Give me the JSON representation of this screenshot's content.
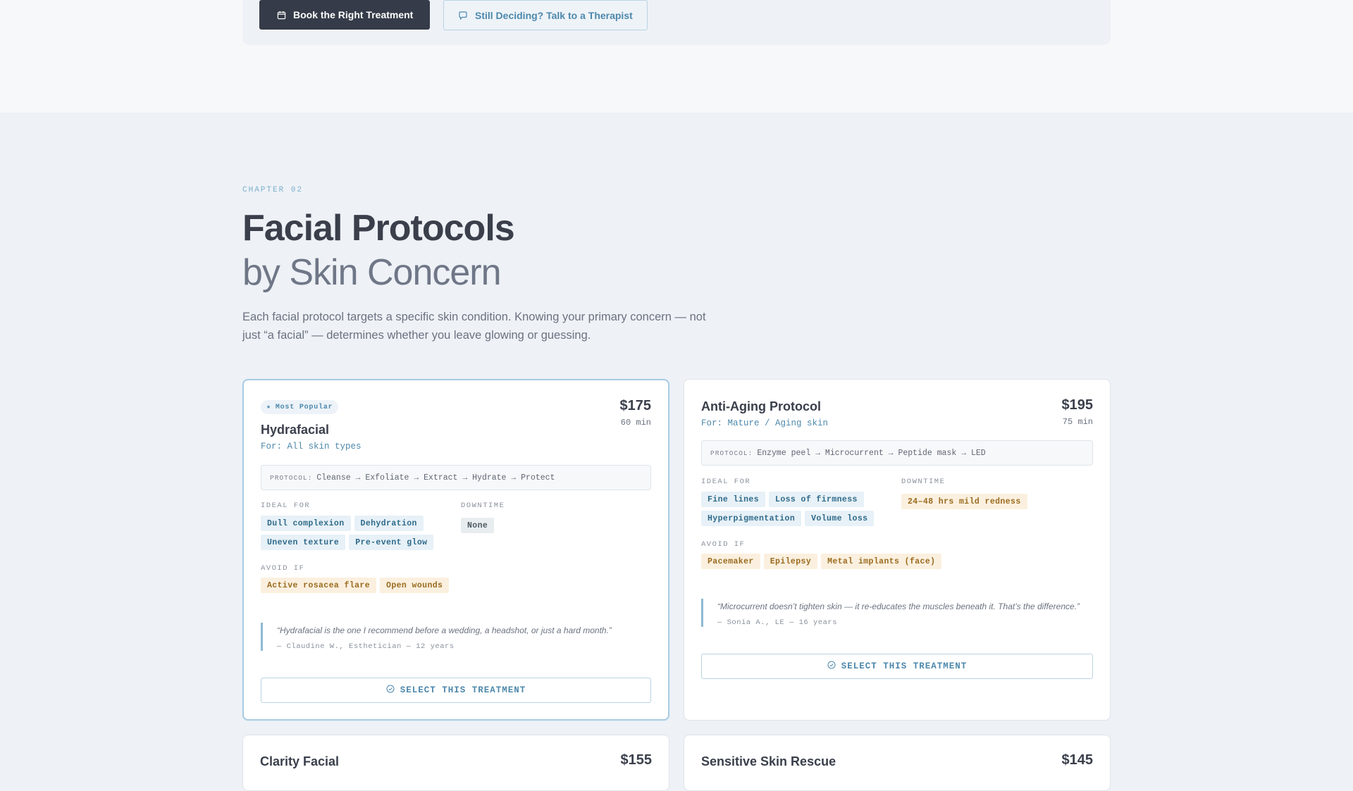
{
  "cta": {
    "primary_label": "Book the Right Treatment",
    "secondary_label": "Still Deciding? Talk to a Therapist"
  },
  "section": {
    "chapter": "CHAPTER 02",
    "title": "Facial Protocols",
    "subtitle": "by Skin Concern",
    "description": "Each facial protocol targets a specific skin condition. Knowing your primary concern — not just “a facial” — determines whether you leave glowing or guessing."
  },
  "labels": {
    "protocol": "PROTOCOL:",
    "ideal_for": "IDEAL FOR",
    "downtime": "DOWNTIME",
    "avoid_if": "AVOID IF",
    "select": "SELECT THIS TREATMENT"
  },
  "cards": [
    {
      "badge": "Most Popular",
      "title": "Hydrafacial",
      "for": "For: All skin types",
      "price": "$175",
      "duration": "60 min",
      "protocol": "Cleanse → Exfoliate → Extract → Hydrate → Protect",
      "ideal_for": [
        "Dull complexion",
        "Dehydration",
        "Uneven texture",
        "Pre-event glow"
      ],
      "downtime": "None",
      "avoid_if": [
        "Active rosacea flare",
        "Open wounds"
      ],
      "quote": "“Hydrafacial is the one I recommend before a wedding, a headshot, or just a hard month.”",
      "quote_by": "— Claudine W., Esthetician — 12 years"
    },
    {
      "title": "Anti-Aging Protocol",
      "for": "For: Mature / Aging skin",
      "price": "$195",
      "duration": "75 min",
      "protocol": "Enzyme peel → Microcurrent → Peptide mask → LED",
      "ideal_for": [
        "Fine lines",
        "Loss of firmness",
        "Hyperpigmentation",
        "Volume loss"
      ],
      "downtime": "24–48 hrs mild redness",
      "avoid_if": [
        "Pacemaker",
        "Epilepsy",
        "Metal implants (face)"
      ],
      "quote": "“Microcurrent doesn’t tighten skin — it re-educates the muscles beneath it. That’s the difference.”",
      "quote_by": "— Sonia A., LE — 16 years"
    },
    {
      "title": "Clarity Facial",
      "price": "$155"
    },
    {
      "title": "Sensitive Skin Rescue",
      "price": "$145"
    }
  ]
}
